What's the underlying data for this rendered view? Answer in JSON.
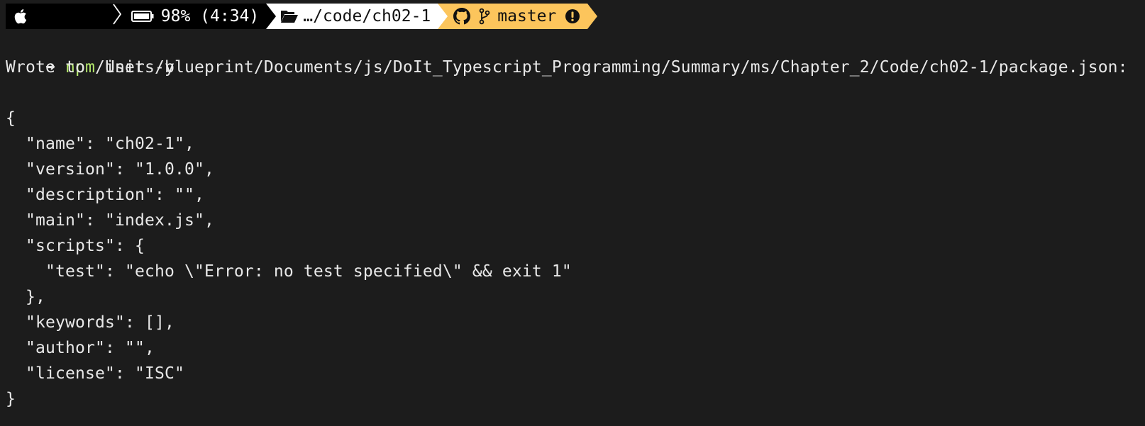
{
  "prompt": {
    "battery_text": "98% (4:34)",
    "directory": "…/code/ch02-1",
    "branch": "master",
    "icons": [
      "apple-icon",
      "battery-icon",
      "folder-open-icon",
      "github-icon",
      "git-branch-icon",
      "alert-circle-icon"
    ],
    "colors": {
      "segment_dark": "#000000",
      "segment_dir": "#ffffff",
      "segment_git": "#fcc55c",
      "command_highlight": "#b4e86c"
    }
  },
  "command": {
    "arrow": "➜",
    "program": "npm",
    "args": " init -y"
  },
  "output": {
    "wrote_line": "Wrote to /Users/blueprint/Documents/js/DoIt_Typescript_Programming/Summary/ms/Chapter_2/Code/ch02-1/package.json:",
    "json_lines": [
      "{",
      "  \"name\": \"ch02-1\",",
      "  \"version\": \"1.0.0\",",
      "  \"description\": \"\",",
      "  \"main\": \"index.js\",",
      "  \"scripts\": {",
      "    \"test\": \"echo \\\"Error: no test specified\\\" && exit 1\"",
      "  },",
      "  \"keywords\": [],",
      "  \"author\": \"\",",
      "  \"license\": \"ISC\"",
      "}"
    ]
  }
}
